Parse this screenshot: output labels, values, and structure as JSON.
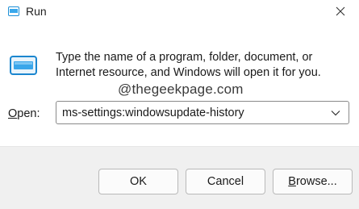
{
  "window": {
    "title": "Run",
    "app_icon": "run-app-icon",
    "close_icon": "close-icon"
  },
  "content": {
    "description": "Type the name of a program, folder, document, or Internet resource, and Windows will open it for you.",
    "watermark": "@thegeekpage.com",
    "open_label_prefix": "O",
    "open_label_rest": "pen:",
    "open_value": "ms-settings:windowsupdate-history",
    "dropdown_icon": "chevron-down-icon"
  },
  "buttons": {
    "ok": "OK",
    "cancel": "Cancel",
    "browse_prefix": "B",
    "browse_rest": "rowse..."
  }
}
